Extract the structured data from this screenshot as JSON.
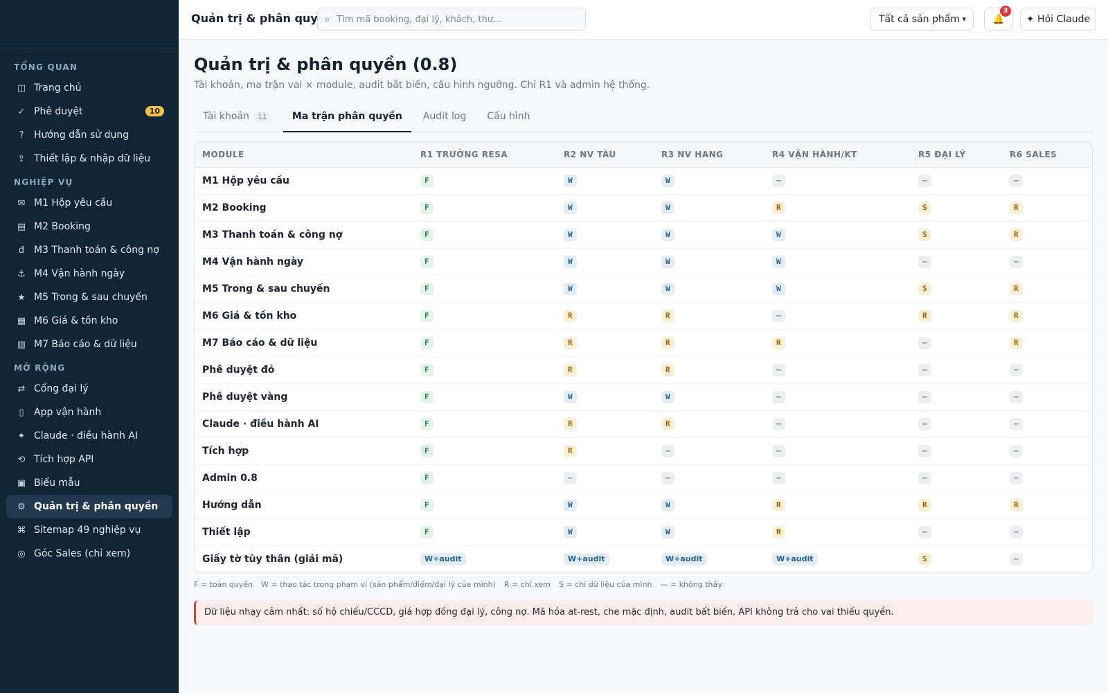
{
  "topbar": {
    "title": "Quản trị & phân quyền",
    "search_placeholder": "Tìm mã booking, đại lý, khách, thư...",
    "product_select": "Tất cả sản phẩm",
    "notification_count": "3",
    "ask_label": "✦ Hỏi Claude"
  },
  "sidebar": {
    "sections": [
      {
        "label": "TỔNG QUAN",
        "items": [
          {
            "icon": "◫",
            "label": "Trang chủ"
          },
          {
            "icon": "✓",
            "label": "Phê duyệt",
            "badge": "10"
          },
          {
            "icon": "?",
            "label": "Hướng dẫn sử dụng"
          },
          {
            "icon": "⇪",
            "label": "Thiết lập & nhập dữ liệu"
          }
        ]
      },
      {
        "label": "NGHIỆP VỤ",
        "items": [
          {
            "icon": "✉",
            "label": "M1 Hộp yêu cầu"
          },
          {
            "icon": "▤",
            "label": "M2 Booking"
          },
          {
            "icon": "đ",
            "label": "M3 Thanh toán & công nợ"
          },
          {
            "icon": "⚓",
            "label": "M4 Vận hành ngày"
          },
          {
            "icon": "★",
            "label": "M5 Trong & sau chuyến"
          },
          {
            "icon": "▦",
            "label": "M6 Giá & tồn kho"
          },
          {
            "icon": "▥",
            "label": "M7 Báo cáo & dữ liệu"
          }
        ]
      },
      {
        "label": "MỞ RỘNG",
        "items": [
          {
            "icon": "⇄",
            "label": "Cổng đại lý"
          },
          {
            "icon": "▯",
            "label": "App vận hành"
          },
          {
            "icon": "✦",
            "label": "Claude · điều hành AI"
          },
          {
            "icon": "⟲",
            "label": "Tích hợp API"
          },
          {
            "icon": "▣",
            "label": "Biểu mẫu"
          },
          {
            "icon": "⚙",
            "label": "Quản trị & phân quyền",
            "active": true
          },
          {
            "icon": "⌘",
            "label": "Sitemap 49 nghiệp vụ"
          },
          {
            "icon": "◎",
            "label": "Góc Sales (chỉ xem)"
          }
        ]
      }
    ]
  },
  "page": {
    "title": "Quản trị & phân quyền (0.8)",
    "subtitle": "Tài khoản, ma trận vai × module, audit bất biến, cấu hình ngưỡng. Chỉ R1 và admin hệ thống."
  },
  "tabs": [
    {
      "label": "Tài khoản",
      "count": "11"
    },
    {
      "label": "Ma trận phân quyền",
      "active": true
    },
    {
      "label": "Audit log"
    },
    {
      "label": "Cấu hình"
    }
  ],
  "matrix": {
    "headers": [
      "MODULE",
      "R1 TRƯỞNG RESA",
      "R2 NV TÀU",
      "R3 NV HANG",
      "R4 VẬN HÀNH/KT",
      "R5 ĐẠI LÝ",
      "R6 SALES"
    ],
    "rows": [
      {
        "module": "M1 Hộp yêu cầu",
        "cells": [
          "F",
          "W",
          "W",
          "—",
          "—",
          "—"
        ]
      },
      {
        "module": "M2 Booking",
        "cells": [
          "F",
          "W",
          "W",
          "R",
          "S",
          "R"
        ]
      },
      {
        "module": "M3 Thanh toán & công nợ",
        "cells": [
          "F",
          "W",
          "W",
          "W",
          "S",
          "R"
        ]
      },
      {
        "module": "M4 Vận hành ngày",
        "cells": [
          "F",
          "W",
          "W",
          "W",
          "—",
          "—"
        ]
      },
      {
        "module": "M5 Trong & sau chuyến",
        "cells": [
          "F",
          "W",
          "W",
          "W",
          "S",
          "R"
        ]
      },
      {
        "module": "M6 Giá & tồn kho",
        "cells": [
          "F",
          "R",
          "R",
          "—",
          "R",
          "R"
        ]
      },
      {
        "module": "M7 Báo cáo & dữ liệu",
        "cells": [
          "F",
          "R",
          "R",
          "R",
          "—",
          "R"
        ]
      },
      {
        "module": "Phê duyệt đỏ",
        "cells": [
          "F",
          "R",
          "R",
          "—",
          "—",
          "—"
        ]
      },
      {
        "module": "Phê duyệt vàng",
        "cells": [
          "F",
          "W",
          "W",
          "—",
          "—",
          "—"
        ]
      },
      {
        "module": "Claude · điều hành AI",
        "cells": [
          "F",
          "R",
          "R",
          "—",
          "—",
          "—"
        ]
      },
      {
        "module": "Tích hợp",
        "cells": [
          "F",
          "R",
          "—",
          "—",
          "—",
          "—"
        ]
      },
      {
        "module": "Admin 0.8",
        "cells": [
          "F",
          "—",
          "—",
          "—",
          "—",
          "—"
        ]
      },
      {
        "module": "Hướng dẫn",
        "cells": [
          "F",
          "W",
          "W",
          "R",
          "R",
          "R"
        ]
      },
      {
        "module": "Thiết lập",
        "cells": [
          "F",
          "W",
          "W",
          "R",
          "—",
          "—"
        ]
      },
      {
        "module": "Giấy tờ tùy thân (giải mã)",
        "cells": [
          "W+audit",
          "W+audit",
          "W+audit",
          "W+audit",
          "S",
          "—"
        ]
      }
    ]
  },
  "legend": [
    "F = toàn quyền",
    "W = thao tác trong phạm vi (sản phẩm/điểm/đại lý của mình)",
    "R = chỉ xem",
    "S = chỉ dữ liệu của mình",
    "— = không thấy"
  ],
  "alert": "Dữ liệu nhạy cảm nhất: số hộ chiếu/CCCD, giá hợp đồng đại lý, công nợ. Mã hóa at-rest, che mặc định, audit bất biến, API không trả cho vai thiếu quyền.",
  "colors": {
    "sidebar_bg": "#102536",
    "full": "#2f7d4b",
    "write": "#2b5f86",
    "read": "#9a6412",
    "alert": "#d64545"
  }
}
